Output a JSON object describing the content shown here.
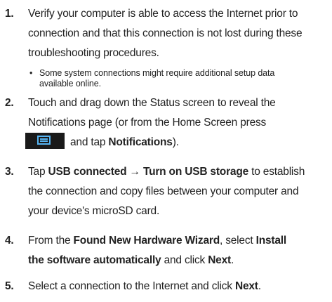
{
  "steps": [
    {
      "number": "1.",
      "line1": "Verify your computer is able to access the Internet prior to",
      "line2": "connection and that this connection is not lost during these",
      "line3": "troubleshooting procedures."
    },
    {
      "number": "2.",
      "line1": "Touch and drag down the Status screen to reveal the",
      "line2": "Notifications page (or from the Home Screen press",
      "line3_suffix": "and tap ",
      "line3_bold": "Notifications",
      "line3_end": ")."
    },
    {
      "number": "3.",
      "line1_prefix": "Tap ",
      "line1_bold": "USB connected → Turn on USB storage",
      "line1_suffix": " to establish",
      "line2": "the connection and copy files between your computer and",
      "line3": "your device's microSD card."
    },
    {
      "number": "4.",
      "line1_prefix": "From the ",
      "line1_bold1": "Found New Hardware Wizard",
      "line1_mid": ", select ",
      "line1_bold2": "Install",
      "line2_bold": "the software automatically",
      "line2_mid": " and click ",
      "line2_bold2": "Next",
      "line2_end": "."
    },
    {
      "number": "5.",
      "line1_prefix": "Select a connection to the Internet and click ",
      "line1_bold": "Next",
      "line1_end": "."
    }
  ],
  "bullet": {
    "symbol": "•",
    "line1": "Some system connections might require additional setup data",
    "line2": "available online."
  },
  "icons": {
    "menu": "menu-key-icon"
  },
  "colors": {
    "text": "#222222",
    "icon_bg": "#1a1a1a",
    "icon_fg": "#56b4f2"
  }
}
